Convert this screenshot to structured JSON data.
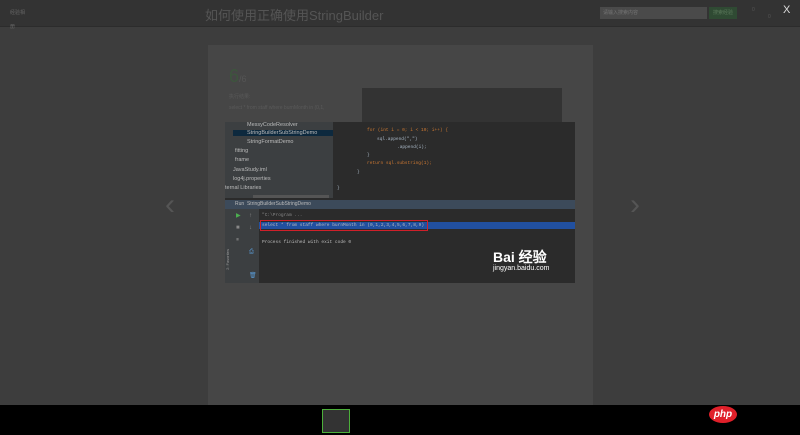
{
  "header": {
    "logo": "经验相册",
    "title": "如何使用正确使用StringBuilder",
    "search_placeholder": "请输入搜索内容",
    "search_button": "搜索经验",
    "count1": "0",
    "count2": "0",
    "close": "X"
  },
  "article": {
    "page_current": "6",
    "page_total": "/6",
    "heading": "执行结果:",
    "text": "select * from staff where burnMonth in (0,1,"
  },
  "nav": {
    "prev": "‹",
    "next": "›"
  },
  "ide": {
    "tree": [
      "MessyCodeResolver",
      "StringBuilderSubStringDemo",
      "StringFormatDemo",
      "fitting",
      "frame",
      "JavaStudy.iml",
      "log4j.properties",
      "ternal Libraries"
    ],
    "code": [
      "for (int i = 0; i < 10; i++) {",
      "sql.append(\",\")",
      ".append(i);",
      "}",
      "return sql.substring(1);",
      "}",
      "}"
    ],
    "run_label": "Run",
    "run_config": "StringBuilderSubStringDemo",
    "console": [
      "\"C:\\Program ...",
      "select * from staff where burnMonth in (0,1,2,3,4,5,6,7,8,9)",
      "Process finished with exit code 0"
    ],
    "favorites": "2: Favorites",
    "watermark": "Bai 经验",
    "watermark_url": "jingyan.baidu.com"
  },
  "footer": {
    "badge": "php"
  }
}
